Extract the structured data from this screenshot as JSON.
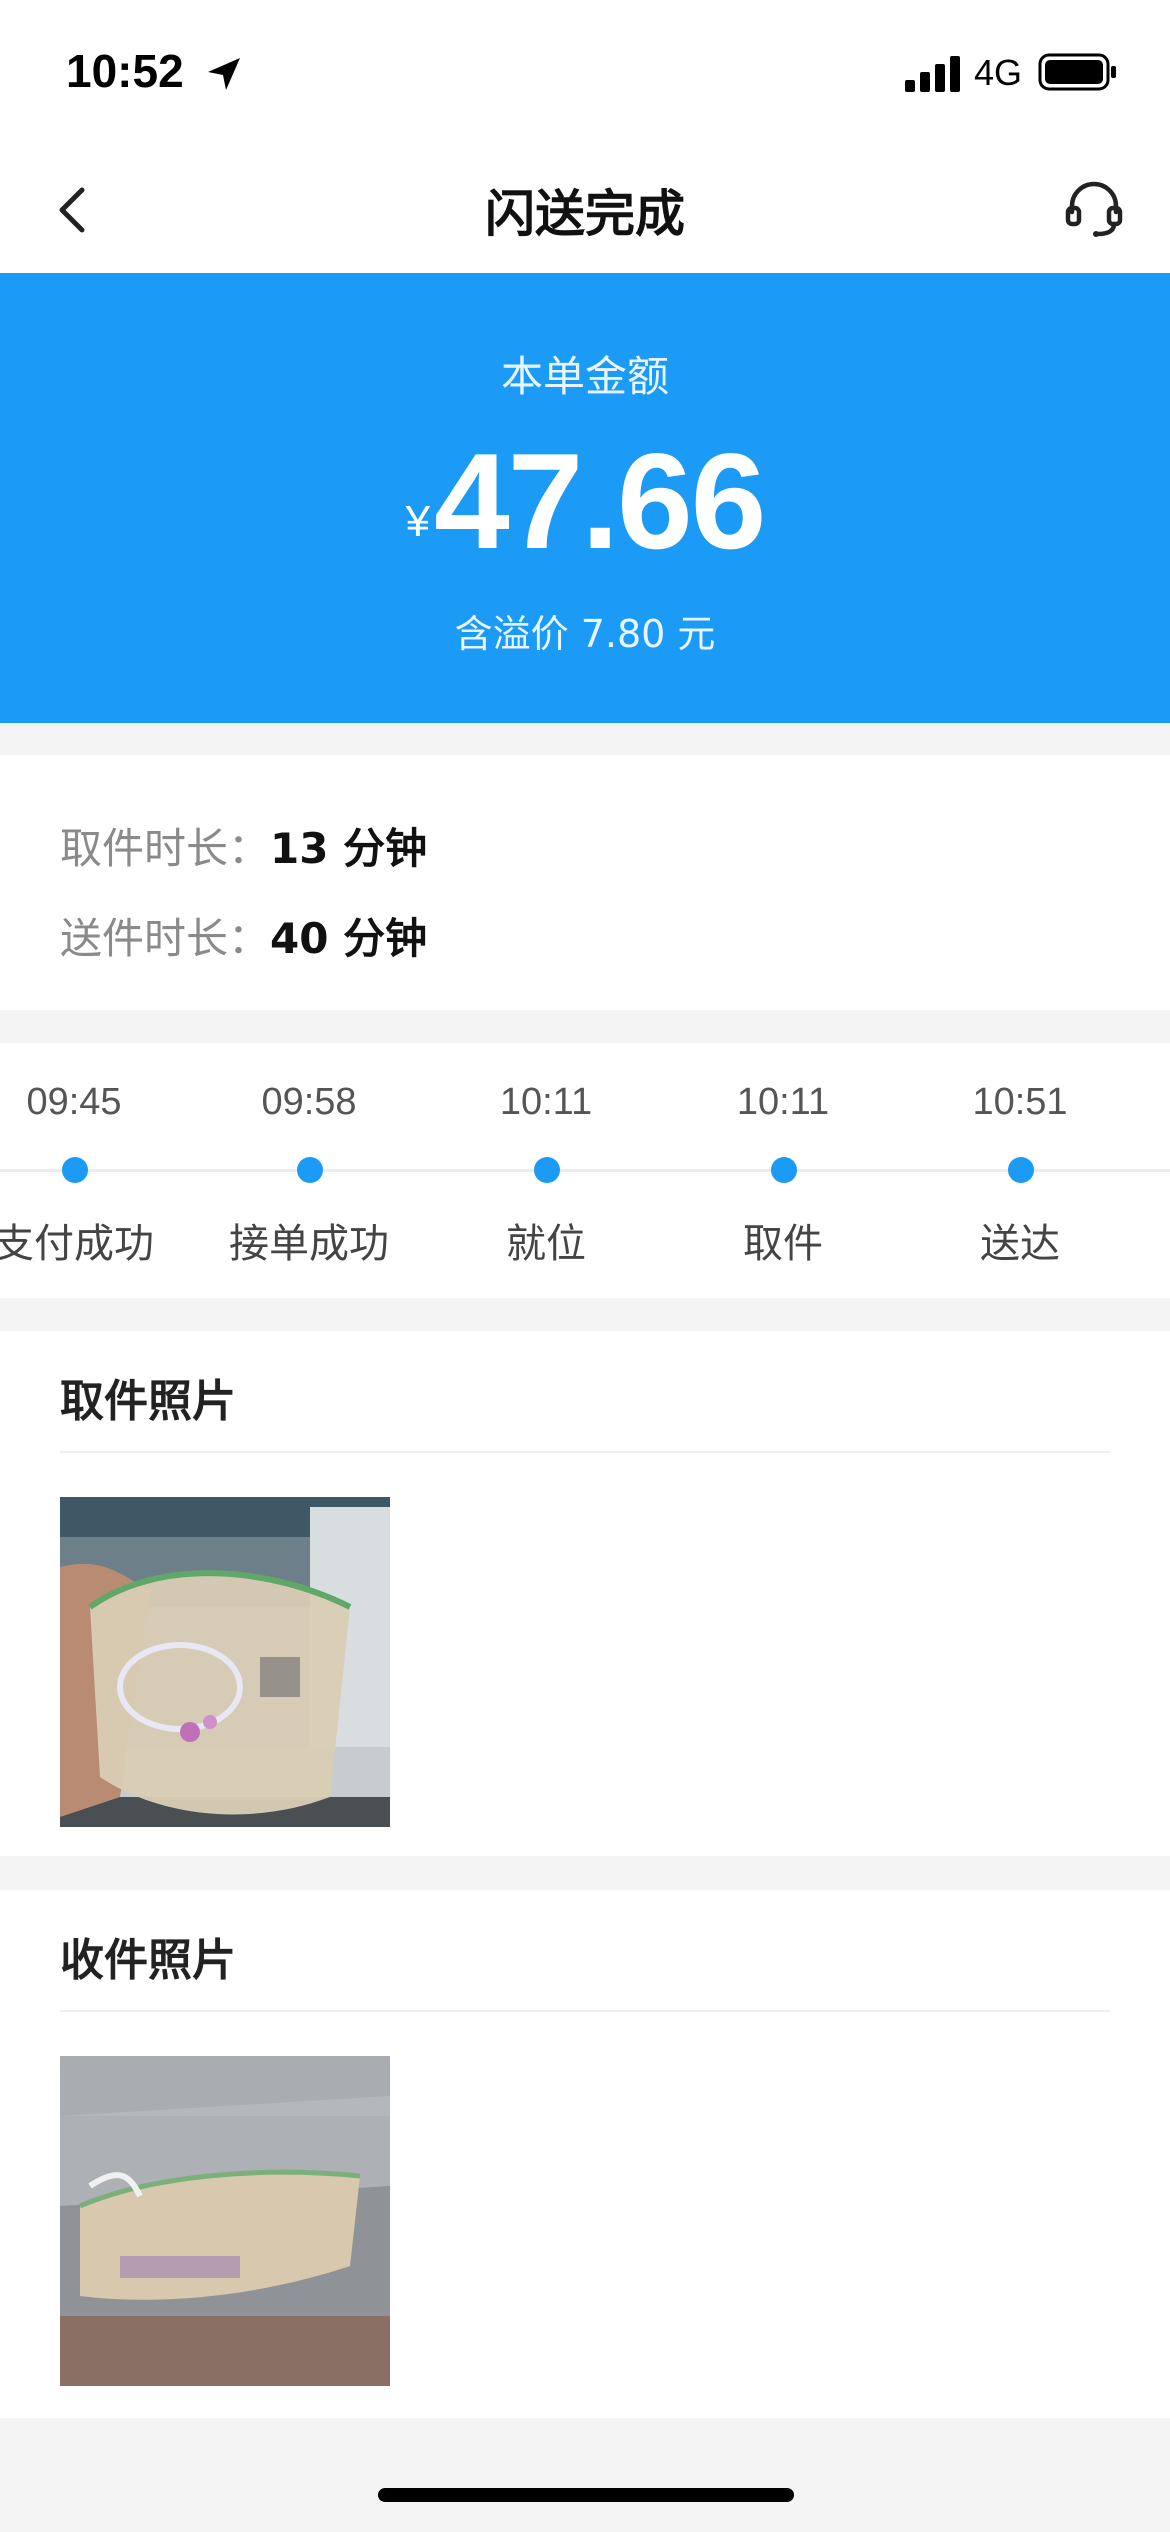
{
  "status_bar": {
    "time": "10:52",
    "network": "4G",
    "icons": [
      "location-arrow-icon",
      "signal-icon",
      "battery-icon"
    ]
  },
  "nav": {
    "title": "闪送完成",
    "icons": [
      "back-chevron-icon",
      "headset-icon"
    ]
  },
  "banner": {
    "label": "本单金额",
    "currency": "¥",
    "amount": "47.66",
    "note": "含溢价 7.80 元",
    "color": "#1b9bf5"
  },
  "durations": [
    {
      "key": "取件时长：",
      "value": "13 分钟"
    },
    {
      "key": "送件时长：",
      "value": "40 分钟"
    }
  ],
  "timeline": [
    {
      "time": "09:45",
      "label": "支付成功"
    },
    {
      "time": "09:58",
      "label": "接单成功"
    },
    {
      "time": "10:11",
      "label": "就位"
    },
    {
      "time": "10:11",
      "label": "取件"
    },
    {
      "time": "10:51",
      "label": "送达"
    }
  ],
  "pickup_photos": {
    "title": "取件照片"
  },
  "receipt_photos": {
    "title": "收件照片"
  }
}
